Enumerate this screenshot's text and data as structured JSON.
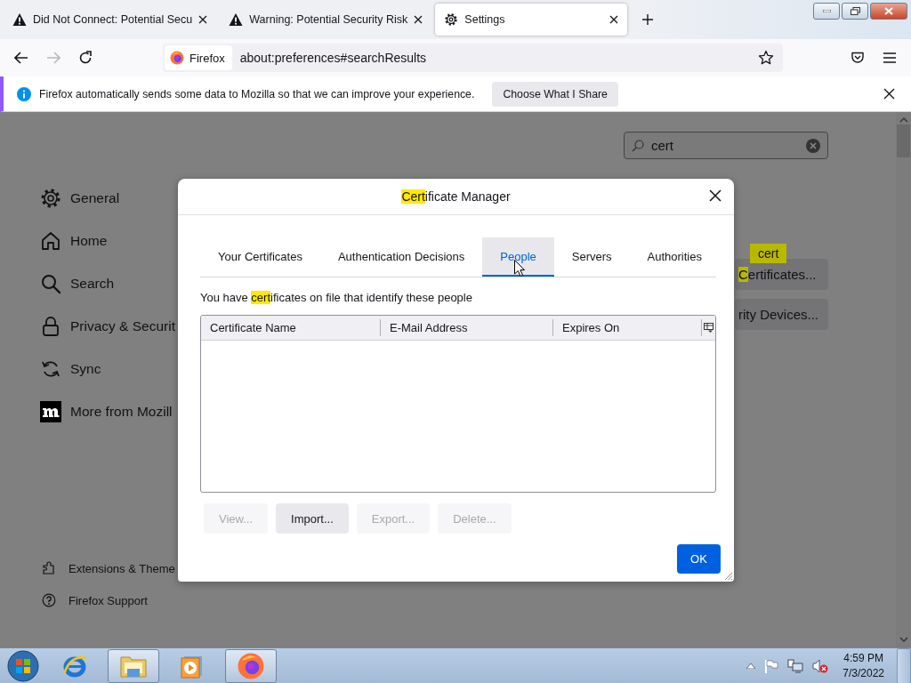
{
  "browser_tabs": [
    {
      "kind": "warning",
      "title": "Did Not Connect: Potential Secu",
      "selected": false
    },
    {
      "kind": "warning",
      "title": "Warning: Potential Security Risk",
      "selected": false
    },
    {
      "kind": "settings",
      "title": "Settings",
      "selected": true
    }
  ],
  "address_bar": {
    "identity": "Firefox",
    "url": "about:preferences#searchResults"
  },
  "notification": {
    "message": "Firefox automatically sends some data to Mozilla so that we can improve your experience.",
    "button": "Choose What I Share"
  },
  "search": {
    "value": "cert"
  },
  "sidebar": {
    "items": [
      {
        "kind": "general",
        "label": "General"
      },
      {
        "kind": "home",
        "label": "Home"
      },
      {
        "kind": "search",
        "label": "Search"
      },
      {
        "kind": "privacy",
        "label": "Privacy & Securit"
      },
      {
        "kind": "sync",
        "label": "Sync"
      },
      {
        "kind": "more",
        "label": "More from Mozill"
      }
    ],
    "footer": [
      {
        "kind": "extensions",
        "label": "Extensions & Theme"
      },
      {
        "kind": "support",
        "label": "Firefox Support"
      }
    ]
  },
  "search_tooltip": "cert",
  "background_buttons": [
    {
      "parts": [
        {
          "text": "C",
          "highlighted": true
        },
        {
          "text": "ertificates...",
          "highlighted": false
        }
      ]
    },
    {
      "parts": [
        {
          "text": "rity Devices...",
          "highlighted": false
        }
      ]
    }
  ],
  "dialog": {
    "title_parts": [
      {
        "text": "Cert",
        "highlighted": true
      },
      {
        "text": "ificate Manager",
        "highlighted": false
      }
    ],
    "tabs": [
      {
        "label": "Your Certificates",
        "selected": false
      },
      {
        "label": "Authentication Decisions",
        "selected": false
      },
      {
        "label": "People",
        "selected": true
      },
      {
        "label": "Servers",
        "selected": false
      },
      {
        "label": "Authorities",
        "selected": false
      }
    ],
    "description_parts": [
      {
        "text": "You have ",
        "highlighted": false
      },
      {
        "text": "cert",
        "highlighted": true
      },
      {
        "text": "ificates on file that identify these people",
        "highlighted": false
      }
    ],
    "columns": [
      "Certificate Name",
      "E-Mail Address",
      "Expires On"
    ],
    "buttons": [
      {
        "label": "View...",
        "disabled": true
      },
      {
        "label": "Import...",
        "disabled": false
      },
      {
        "label": "Export...",
        "disabled": true
      },
      {
        "label": "Delete...",
        "disabled": true
      }
    ],
    "ok": "OK"
  },
  "taskbar": {
    "apps": [
      {
        "kind": "explorer",
        "running": false
      },
      {
        "kind": "files",
        "running": true
      },
      {
        "kind": "media",
        "running": false
      },
      {
        "kind": "firefox",
        "running": true
      }
    ],
    "time": "4:59 PM",
    "date": "7/3/2022"
  }
}
